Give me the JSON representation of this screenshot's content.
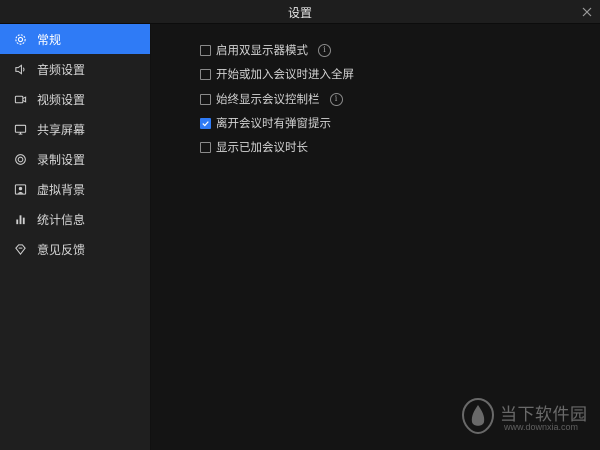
{
  "window": {
    "title": "设置"
  },
  "sidebar": {
    "items": [
      {
        "label": "常规",
        "icon": "gear-icon",
        "active": true
      },
      {
        "label": "音频设置",
        "icon": "speaker-icon"
      },
      {
        "label": "视频设置",
        "icon": "video-camera-icon"
      },
      {
        "label": "共享屏幕",
        "icon": "monitor-icon"
      },
      {
        "label": "录制设置",
        "icon": "record-icon"
      },
      {
        "label": "虚拟背景",
        "icon": "portrait-icon"
      },
      {
        "label": "统计信息",
        "icon": "bar-chart-icon"
      },
      {
        "label": "意见反馈",
        "icon": "feedback-icon"
      }
    ]
  },
  "general": {
    "options": [
      {
        "label": "启用双显示器模式",
        "checked": false,
        "info": true
      },
      {
        "label": "开始或加入会议时进入全屏",
        "checked": false,
        "info": false
      },
      {
        "label": "始终显示会议控制栏",
        "checked": false,
        "info": true
      },
      {
        "label": "离开会议时有弹窗提示",
        "checked": true,
        "info": false
      },
      {
        "label": "显示已加会议时长",
        "checked": false,
        "info": false
      }
    ],
    "info_glyph": "i"
  },
  "watermark": {
    "text": "当下软件园",
    "url": "www.downxia.com"
  },
  "colors": {
    "accent": "#2f7bf6",
    "background": "#141414",
    "sidebar": "#1f1f1f"
  }
}
